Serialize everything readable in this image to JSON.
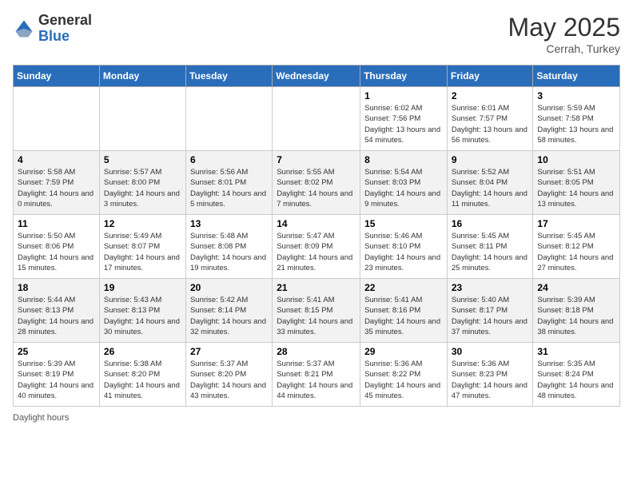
{
  "header": {
    "logo_general": "General",
    "logo_blue": "Blue",
    "title": "May 2025",
    "location": "Cerrah, Turkey"
  },
  "days_of_week": [
    "Sunday",
    "Monday",
    "Tuesday",
    "Wednesday",
    "Thursday",
    "Friday",
    "Saturday"
  ],
  "weeks": [
    [
      {
        "day": "",
        "info": ""
      },
      {
        "day": "",
        "info": ""
      },
      {
        "day": "",
        "info": ""
      },
      {
        "day": "",
        "info": ""
      },
      {
        "day": "1",
        "sunrise": "Sunrise: 6:02 AM",
        "sunset": "Sunset: 7:56 PM",
        "daylight": "Daylight: 13 hours and 54 minutes."
      },
      {
        "day": "2",
        "sunrise": "Sunrise: 6:01 AM",
        "sunset": "Sunset: 7:57 PM",
        "daylight": "Daylight: 13 hours and 56 minutes."
      },
      {
        "day": "3",
        "sunrise": "Sunrise: 5:59 AM",
        "sunset": "Sunset: 7:58 PM",
        "daylight": "Daylight: 13 hours and 58 minutes."
      }
    ],
    [
      {
        "day": "4",
        "sunrise": "Sunrise: 5:58 AM",
        "sunset": "Sunset: 7:59 PM",
        "daylight": "Daylight: 14 hours and 0 minutes."
      },
      {
        "day": "5",
        "sunrise": "Sunrise: 5:57 AM",
        "sunset": "Sunset: 8:00 PM",
        "daylight": "Daylight: 14 hours and 3 minutes."
      },
      {
        "day": "6",
        "sunrise": "Sunrise: 5:56 AM",
        "sunset": "Sunset: 8:01 PM",
        "daylight": "Daylight: 14 hours and 5 minutes."
      },
      {
        "day": "7",
        "sunrise": "Sunrise: 5:55 AM",
        "sunset": "Sunset: 8:02 PM",
        "daylight": "Daylight: 14 hours and 7 minutes."
      },
      {
        "day": "8",
        "sunrise": "Sunrise: 5:54 AM",
        "sunset": "Sunset: 8:03 PM",
        "daylight": "Daylight: 14 hours and 9 minutes."
      },
      {
        "day": "9",
        "sunrise": "Sunrise: 5:52 AM",
        "sunset": "Sunset: 8:04 PM",
        "daylight": "Daylight: 14 hours and 11 minutes."
      },
      {
        "day": "10",
        "sunrise": "Sunrise: 5:51 AM",
        "sunset": "Sunset: 8:05 PM",
        "daylight": "Daylight: 14 hours and 13 minutes."
      }
    ],
    [
      {
        "day": "11",
        "sunrise": "Sunrise: 5:50 AM",
        "sunset": "Sunset: 8:06 PM",
        "daylight": "Daylight: 14 hours and 15 minutes."
      },
      {
        "day": "12",
        "sunrise": "Sunrise: 5:49 AM",
        "sunset": "Sunset: 8:07 PM",
        "daylight": "Daylight: 14 hours and 17 minutes."
      },
      {
        "day": "13",
        "sunrise": "Sunrise: 5:48 AM",
        "sunset": "Sunset: 8:08 PM",
        "daylight": "Daylight: 14 hours and 19 minutes."
      },
      {
        "day": "14",
        "sunrise": "Sunrise: 5:47 AM",
        "sunset": "Sunset: 8:09 PM",
        "daylight": "Daylight: 14 hours and 21 minutes."
      },
      {
        "day": "15",
        "sunrise": "Sunrise: 5:46 AM",
        "sunset": "Sunset: 8:10 PM",
        "daylight": "Daylight: 14 hours and 23 minutes."
      },
      {
        "day": "16",
        "sunrise": "Sunrise: 5:45 AM",
        "sunset": "Sunset: 8:11 PM",
        "daylight": "Daylight: 14 hours and 25 minutes."
      },
      {
        "day": "17",
        "sunrise": "Sunrise: 5:45 AM",
        "sunset": "Sunset: 8:12 PM",
        "daylight": "Daylight: 14 hours and 27 minutes."
      }
    ],
    [
      {
        "day": "18",
        "sunrise": "Sunrise: 5:44 AM",
        "sunset": "Sunset: 8:13 PM",
        "daylight": "Daylight: 14 hours and 28 minutes."
      },
      {
        "day": "19",
        "sunrise": "Sunrise: 5:43 AM",
        "sunset": "Sunset: 8:13 PM",
        "daylight": "Daylight: 14 hours and 30 minutes."
      },
      {
        "day": "20",
        "sunrise": "Sunrise: 5:42 AM",
        "sunset": "Sunset: 8:14 PM",
        "daylight": "Daylight: 14 hours and 32 minutes."
      },
      {
        "day": "21",
        "sunrise": "Sunrise: 5:41 AM",
        "sunset": "Sunset: 8:15 PM",
        "daylight": "Daylight: 14 hours and 33 minutes."
      },
      {
        "day": "22",
        "sunrise": "Sunrise: 5:41 AM",
        "sunset": "Sunset: 8:16 PM",
        "daylight": "Daylight: 14 hours and 35 minutes."
      },
      {
        "day": "23",
        "sunrise": "Sunrise: 5:40 AM",
        "sunset": "Sunset: 8:17 PM",
        "daylight": "Daylight: 14 hours and 37 minutes."
      },
      {
        "day": "24",
        "sunrise": "Sunrise: 5:39 AM",
        "sunset": "Sunset: 8:18 PM",
        "daylight": "Daylight: 14 hours and 38 minutes."
      }
    ],
    [
      {
        "day": "25",
        "sunrise": "Sunrise: 5:39 AM",
        "sunset": "Sunset: 8:19 PM",
        "daylight": "Daylight: 14 hours and 40 minutes."
      },
      {
        "day": "26",
        "sunrise": "Sunrise: 5:38 AM",
        "sunset": "Sunset: 8:20 PM",
        "daylight": "Daylight: 14 hours and 41 minutes."
      },
      {
        "day": "27",
        "sunrise": "Sunrise: 5:37 AM",
        "sunset": "Sunset: 8:20 PM",
        "daylight": "Daylight: 14 hours and 43 minutes."
      },
      {
        "day": "28",
        "sunrise": "Sunrise: 5:37 AM",
        "sunset": "Sunset: 8:21 PM",
        "daylight": "Daylight: 14 hours and 44 minutes."
      },
      {
        "day": "29",
        "sunrise": "Sunrise: 5:36 AM",
        "sunset": "Sunset: 8:22 PM",
        "daylight": "Daylight: 14 hours and 45 minutes."
      },
      {
        "day": "30",
        "sunrise": "Sunrise: 5:36 AM",
        "sunset": "Sunset: 8:23 PM",
        "daylight": "Daylight: 14 hours and 47 minutes."
      },
      {
        "day": "31",
        "sunrise": "Sunrise: 5:35 AM",
        "sunset": "Sunset: 8:24 PM",
        "daylight": "Daylight: 14 hours and 48 minutes."
      }
    ]
  ],
  "footer": {
    "daylight_label": "Daylight hours"
  }
}
